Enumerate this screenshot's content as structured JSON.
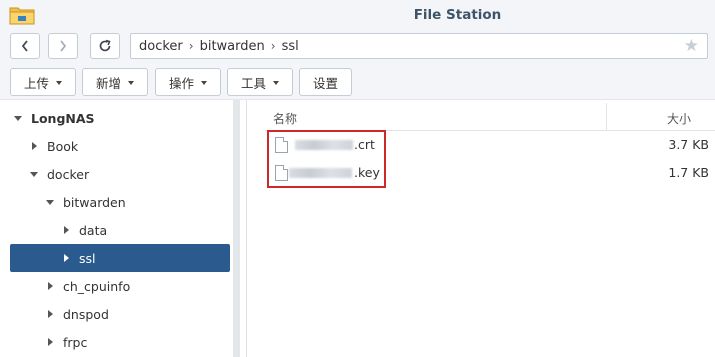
{
  "window": {
    "title": "File Station"
  },
  "nav": {
    "path": [
      "docker",
      "bitwarden",
      "ssl"
    ]
  },
  "toolbar": {
    "upload": "上传",
    "create": "新增",
    "action": "操作",
    "tools": "工具",
    "settings": "设置"
  },
  "sidebar": {
    "root": "LongNAS",
    "items": [
      "Book",
      "docker",
      "bitwarden",
      "data",
      "ssl",
      "ch_cpuinfo",
      "dnspod",
      "frpc"
    ]
  },
  "filelist": {
    "col_name": "名称",
    "col_size": "大小",
    "files": [
      {
        "ext": ".crt",
        "size": "3.7 KB"
      },
      {
        "ext": ".key",
        "size": "1.7 KB"
      }
    ]
  },
  "colors": {
    "selected": "#2b5b8e",
    "highlight": "#cc2a2a",
    "title": "#3e5468"
  }
}
